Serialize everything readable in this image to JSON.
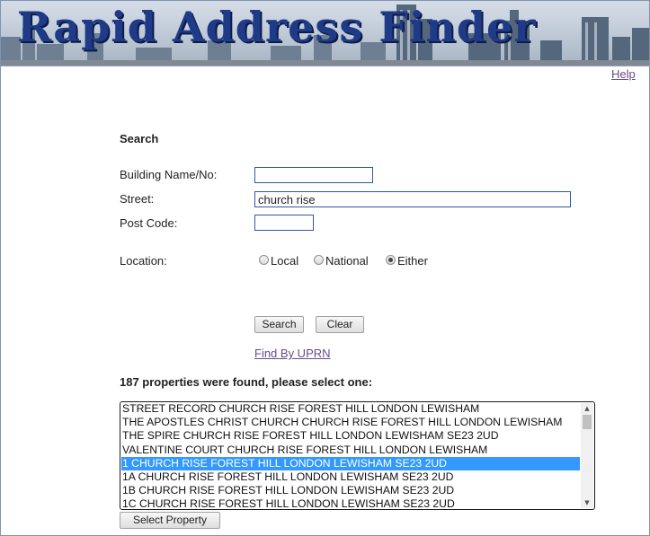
{
  "banner": {
    "title": "Rapid Address Finder"
  },
  "help_label": "Help",
  "search": {
    "heading": "Search",
    "building_label": "Building Name/No:",
    "building_value": "",
    "street_label": "Street:",
    "street_value": "church rise",
    "postcode_label": "Post Code:",
    "postcode_value": "",
    "location_label": "Location:",
    "location_options": [
      "Local",
      "National",
      "Either"
    ],
    "location_selected": "Either",
    "search_button": "Search",
    "clear_button": "Clear",
    "uprn_link": "Find By UPRN"
  },
  "results": {
    "summary": "187 properties were found, please select one:",
    "items": [
      "STREET RECORD CHURCH RISE FOREST HILL LONDON LEWISHAM",
      "THE APOSTLES CHRIST CHURCH CHURCH RISE FOREST HILL LONDON LEWISHAM",
      "THE SPIRE CHURCH RISE FOREST HILL LONDON LEWISHAM SE23 2UD",
      "VALENTINE COURT CHURCH RISE FOREST HILL LONDON LEWISHAM",
      "1 CHURCH RISE FOREST HILL LONDON LEWISHAM SE23 2UD",
      "1A CHURCH RISE FOREST HILL LONDON LEWISHAM SE23 2UD",
      "1B CHURCH RISE FOREST HILL LONDON LEWISHAM SE23 2UD",
      "1C CHURCH RISE FOREST HILL LONDON LEWISHAM SE23 2UD"
    ],
    "selected_index": 4,
    "select_button": "Select Property"
  },
  "colors": {
    "banner_text": "#1f3a86",
    "selection": "#3399ff",
    "link": "#6a4a8a",
    "input_border": "#2a5aa8"
  }
}
